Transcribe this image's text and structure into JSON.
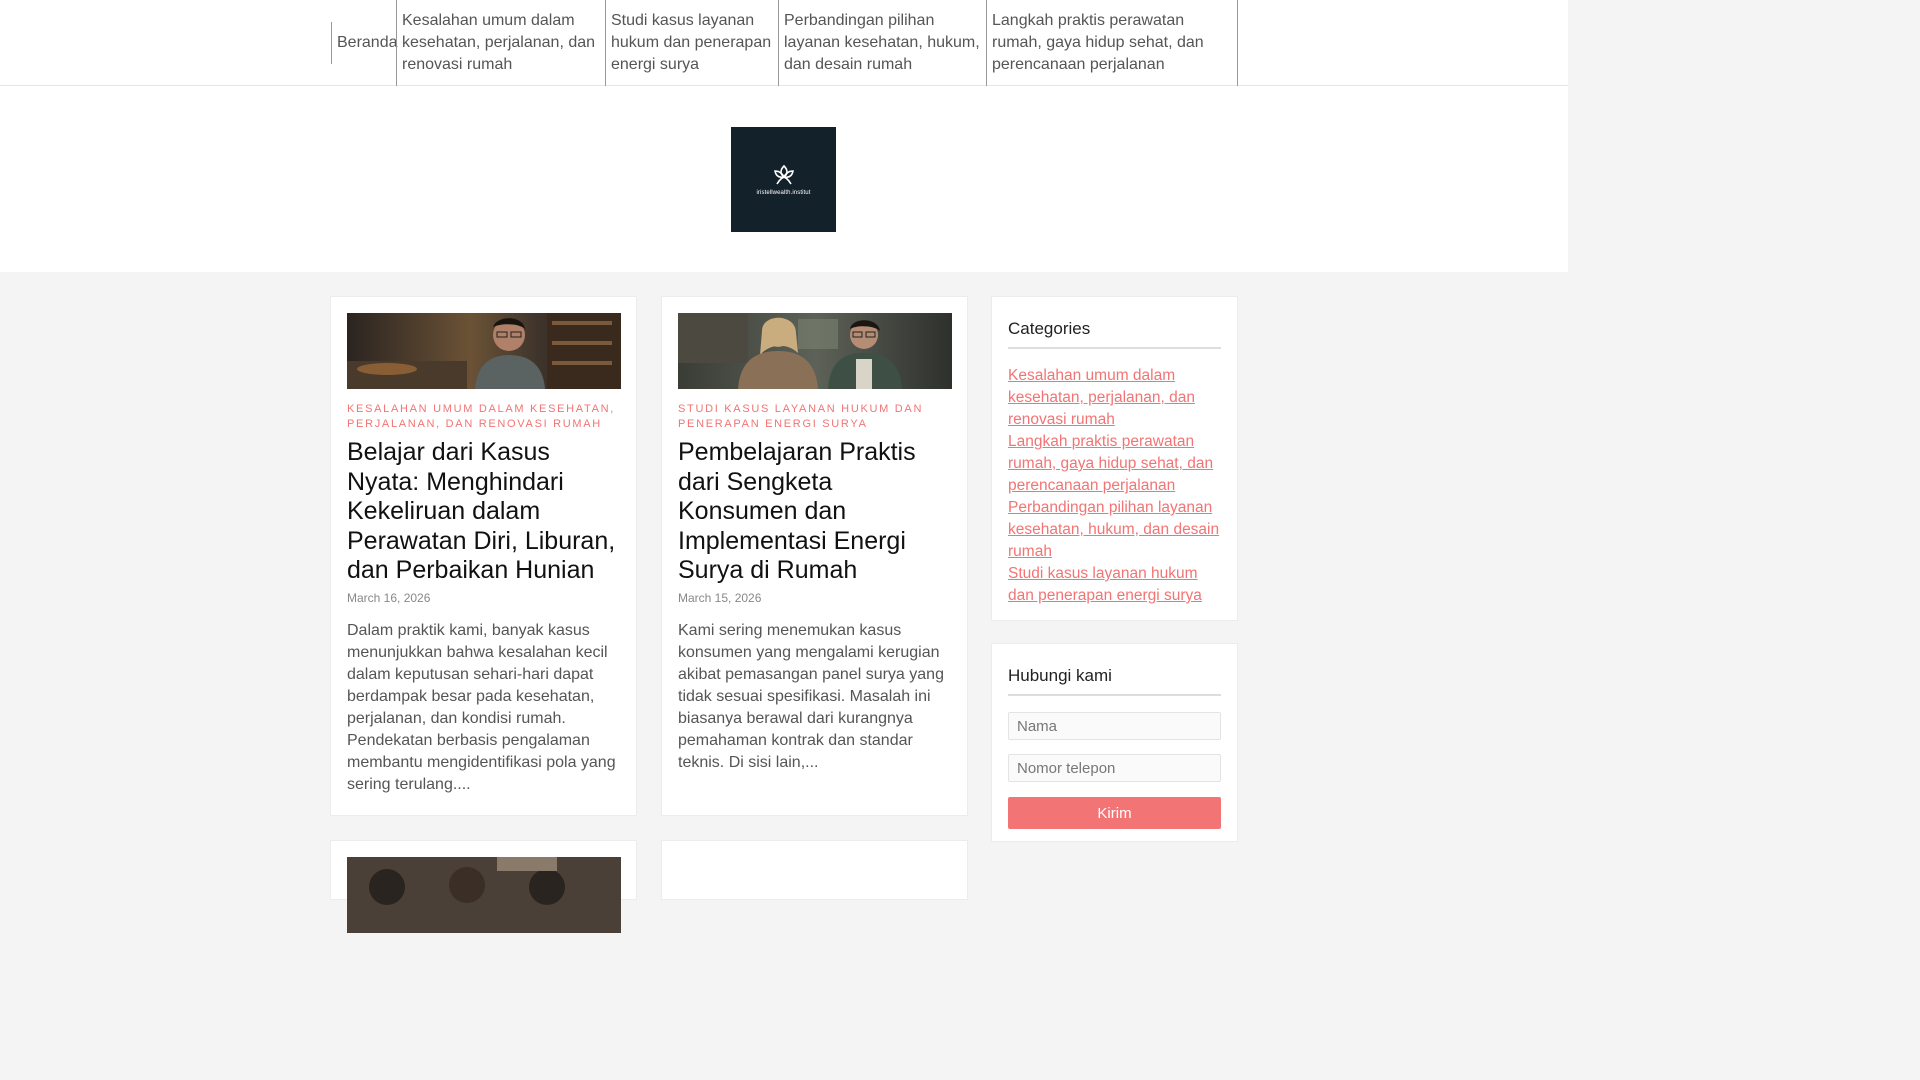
{
  "nav": {
    "items": [
      {
        "label": "Beranda"
      },
      {
        "label": "Kesalahan umum dalam kesehatan, perjalanan, dan renovasi rumah"
      },
      {
        "label": "Studi kasus layanan hukum dan penerapan energi surya"
      },
      {
        "label": "Perbandingan pilihan layanan kesehatan, hukum, dan desain rumah"
      },
      {
        "label": "Langkah praktis perawatan rumah, gaya hidup sehat, dan perencanaan perjalanan"
      }
    ]
  },
  "logo": {
    "text": "iristellwealth.institut",
    "bg_color": "#13212a"
  },
  "posts": [
    {
      "category": "Kesalahan umum dalam kesehatan, perjalanan, dan renovasi rumah",
      "title": "Belajar dari Kasus Nyata: Menghindari Kekeliruan dalam Perawatan Diri, Liburan, dan Perbaikan Hunian",
      "date": "March 16, 2026",
      "excerpt": "Dalam praktik kami, banyak kasus menunjukkan bahwa kesalahan kecil dalam keputusan sehari-hari dapat berdampak besar pada kesehatan, perjalanan, dan kondisi rumah. Pendekatan berbasis pengalaman membantu mengidentifikasi pola yang sering terulang...."
    },
    {
      "category": "Studi kasus layanan hukum dan penerapan energi surya",
      "title": "Pembelajaran Praktis dari Sengketa Konsumen dan Implementasi Energi Surya di Rumah",
      "date": "March 15, 2026",
      "excerpt": "Kami sering menemukan kasus konsumen yang mengalami kerugian akibat pemasangan panel surya yang tidak sesuai spesifikasi. Masalah ini biasanya berawal dari kurangnya pemahaman kontrak dan standar teknis. Di sisi lain,..."
    }
  ],
  "sidebar": {
    "categories_title": "Categories",
    "categories": [
      "Kesalahan umum dalam kesehatan, perjalanan, dan renovasi rumah",
      "Langkah praktis perawatan rumah, gaya hidup sehat, dan perencanaan perjalanan",
      "Perbandingan pilihan layanan kesehatan, hukum, dan desain rumah",
      "Studi kasus layanan hukum dan penerapan energi surya"
    ],
    "contact_title": "Hubungi kami",
    "name_placeholder": "Nama",
    "phone_placeholder": "Nomor telepon",
    "submit_label": "Kirim"
  },
  "colors": {
    "accent": "#f27474",
    "background": "#f4f4f4"
  }
}
